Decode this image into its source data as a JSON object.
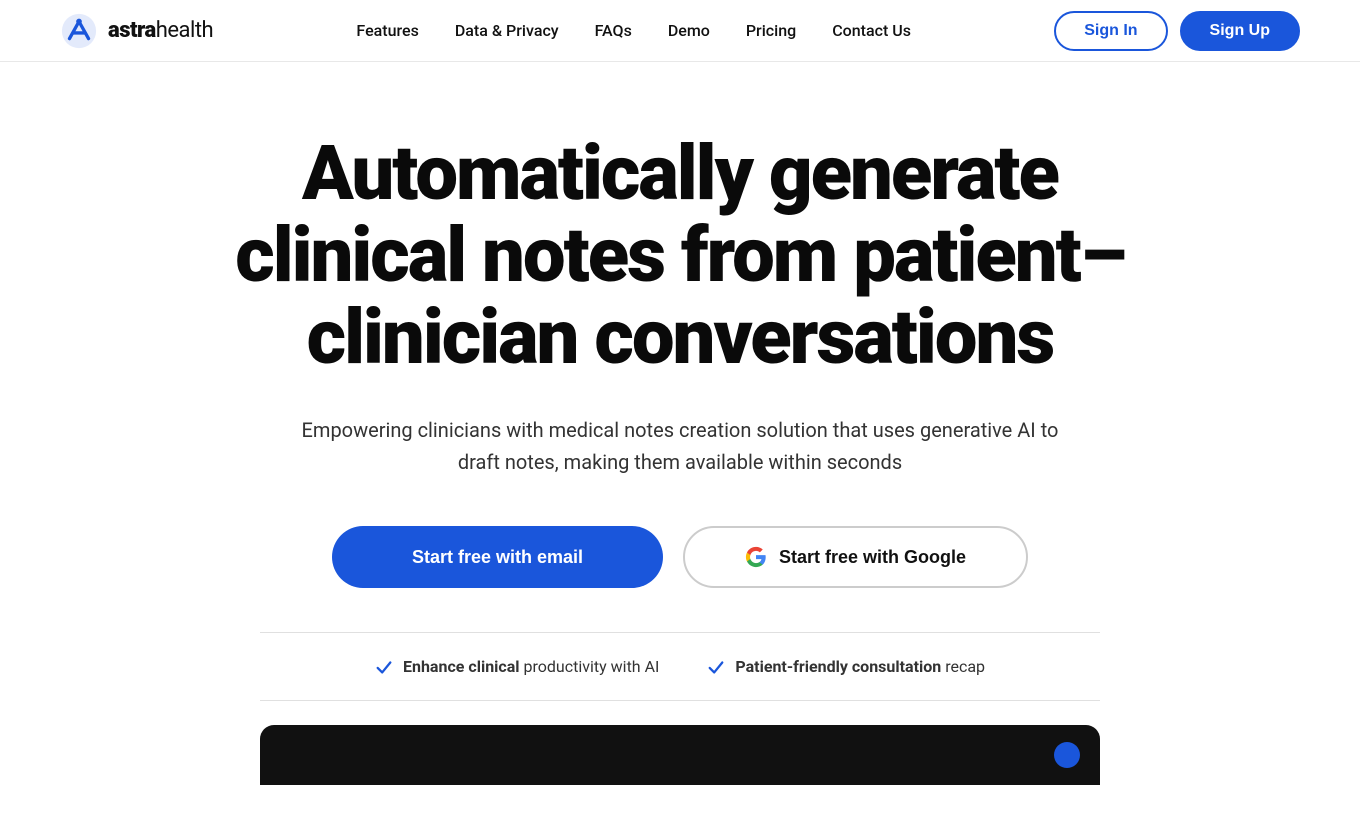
{
  "nav": {
    "logo_text": "astrahealth",
    "logo_brand": "astra",
    "logo_suffix": "health",
    "links": [
      {
        "label": "Features",
        "id": "features"
      },
      {
        "label": "Data & Privacy",
        "id": "data-privacy"
      },
      {
        "label": "FAQs",
        "id": "faqs"
      },
      {
        "label": "Demo",
        "id": "demo"
      },
      {
        "label": "Pricing",
        "id": "pricing"
      },
      {
        "label": "Contact Us",
        "id": "contact"
      }
    ],
    "signin_label": "Sign In",
    "signup_label": "Sign Up"
  },
  "hero": {
    "title": "Automatically generate clinical notes from patient–clinician conversations",
    "subtitle": "Empowering clinicians with medical notes creation solution that uses generative AI to draft notes, making them available within seconds",
    "btn_email": "Start free with email",
    "btn_google": "Start free with Google"
  },
  "features": [
    {
      "label_bold": "Enhance clinical",
      "label_rest": " productivity with AI"
    },
    {
      "label_bold": "Patient-friendly consultation",
      "label_rest": " recap"
    }
  ],
  "icons": {
    "check": "✓",
    "google_colors": [
      "#4285F4",
      "#EA4335",
      "#FBBC05",
      "#34A853"
    ]
  }
}
